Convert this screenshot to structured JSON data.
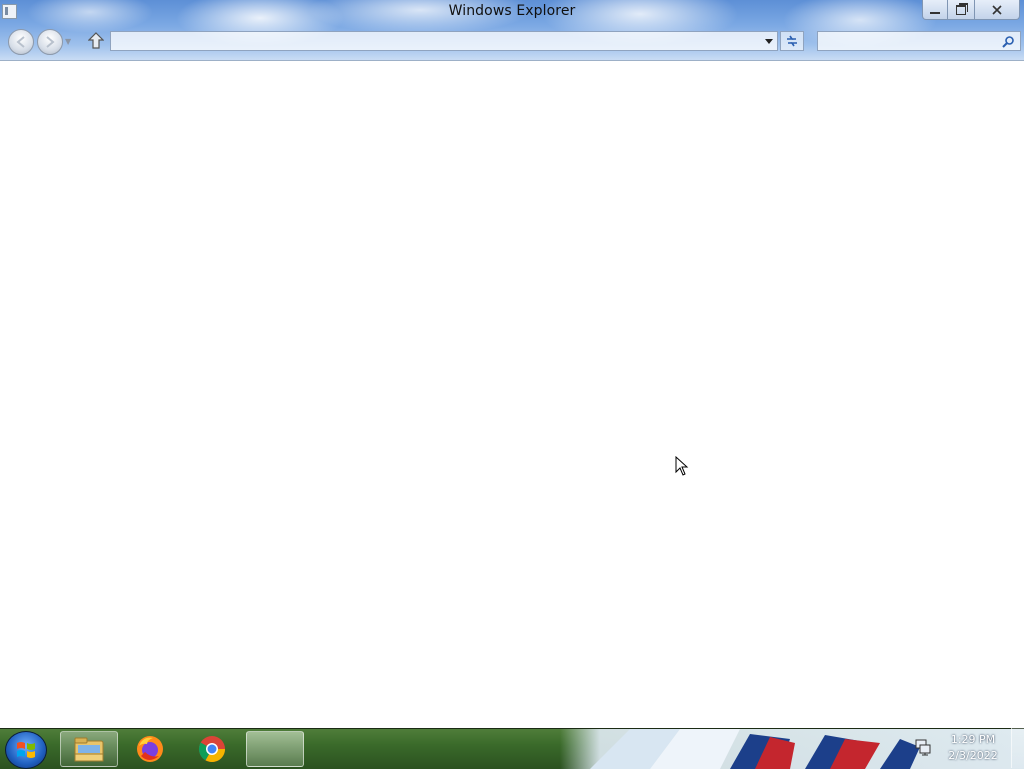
{
  "window": {
    "title": "Windows Explorer",
    "address_value": "",
    "search_placeholder": ""
  },
  "icons": {
    "system_menu": "window-icon",
    "back": "back-arrow-icon",
    "forward": "forward-arrow-icon",
    "up": "up-arrow-icon",
    "refresh": "refresh-icon",
    "search": "search-icon",
    "minimize": "minimize-icon",
    "maximize": "restore-icon",
    "close": "close-icon"
  },
  "taskbar": {
    "pinned": [
      "explorer-folder-icon",
      "firefox-icon",
      "chrome-icon"
    ],
    "clock": {
      "time": "1:29 PM",
      "date": "2/3/2022"
    }
  },
  "colors": {
    "titlebar_sky": "#7aa7e3",
    "taskbar_green": "#3a6a2a",
    "start_orb": "#1f5fbf"
  }
}
